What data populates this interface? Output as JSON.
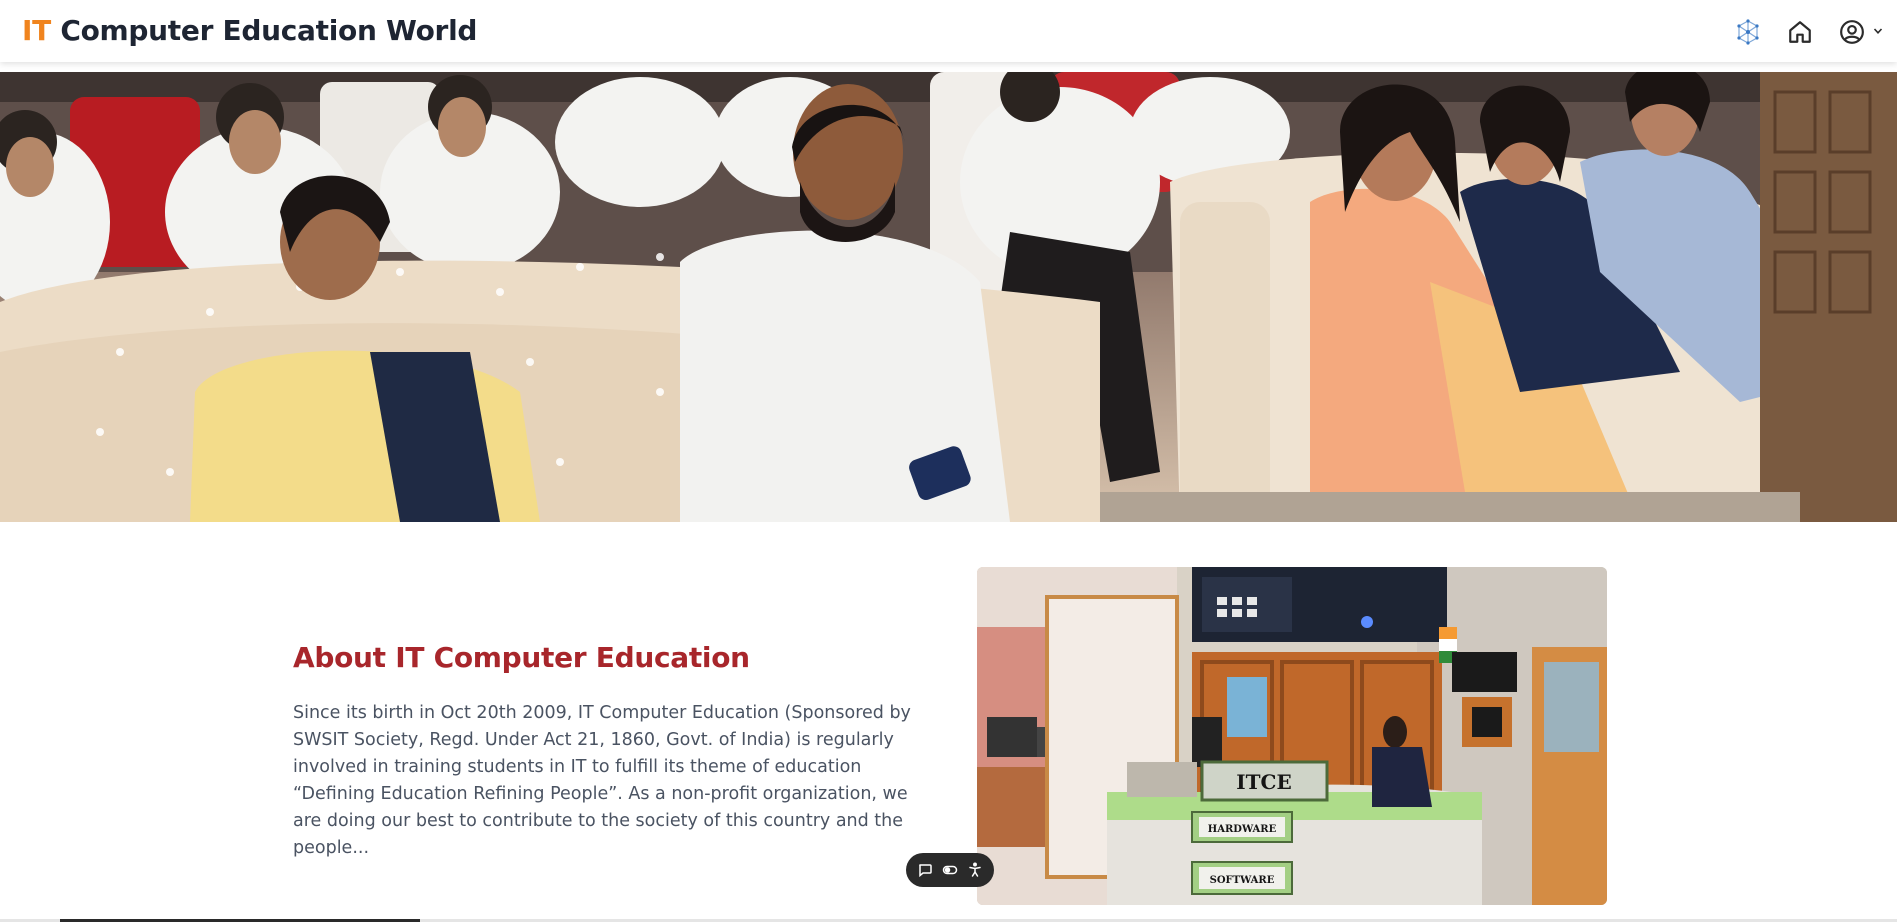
{
  "header": {
    "brand_prefix": "IT",
    "brand_rest": " Computer Education World",
    "icons": [
      "network-icon",
      "home-icon",
      "user-circle-icon",
      "chevron-down-icon"
    ]
  },
  "hero": {
    "image": "hero-photo"
  },
  "about": {
    "title": "About IT Computer Education",
    "description": "Since its birth in Oct 20th 2009, IT Computer Education (Sponsored by SWSIT Society, Regd. Under Act 21, 1860, Govt. of India) is regularly involved in training students in IT to fulfill its theme of education “Defining Education Refining People”. As a non-profit organization, we are doing our best to contribute to the society of this country and the people...",
    "photo_sign": "ITCE",
    "photo_label_1": "HARDWARE",
    "photo_label_2": "SOFTWARE"
  },
  "floating_toolbar": {
    "icons": [
      "chat-icon",
      "toggle-icon",
      "accessibility-icon"
    ]
  },
  "colors": {
    "brand_orange": "#f0841e",
    "brand_dark": "#1e2533",
    "title_red": "#a8262b",
    "text_gray": "#4a5362"
  }
}
